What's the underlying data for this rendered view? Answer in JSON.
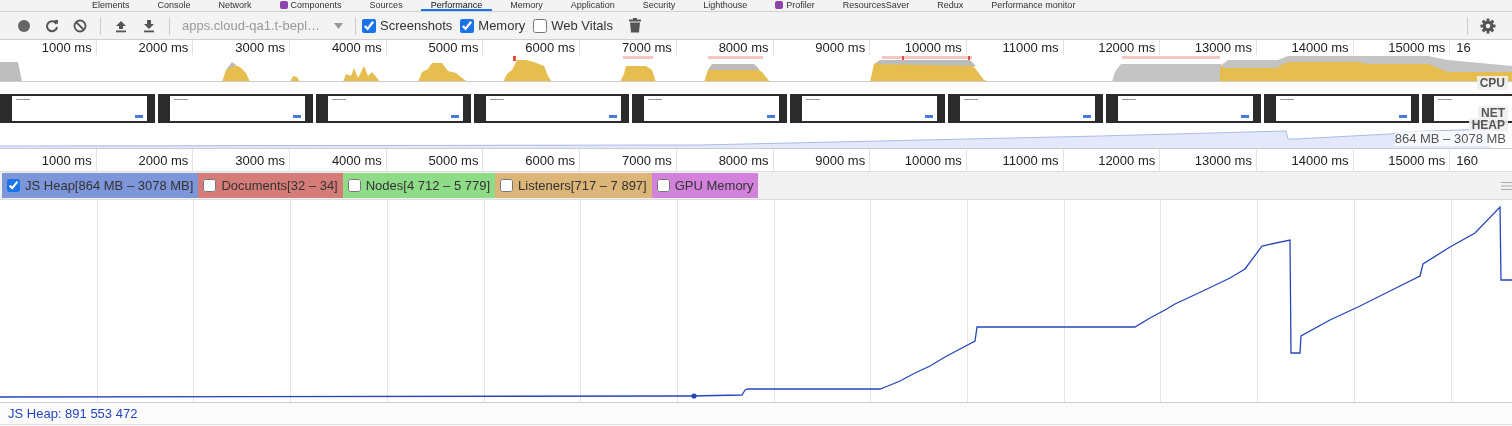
{
  "tabs": [
    {
      "label": "Elements",
      "selected": false,
      "kind": "plain"
    },
    {
      "label": "Console",
      "selected": false,
      "kind": "plain"
    },
    {
      "label": "Network",
      "selected": false,
      "kind": "plain"
    },
    {
      "label": "Components",
      "selected": false,
      "kind": "extension"
    },
    {
      "label": "Sources",
      "selected": false,
      "kind": "plain"
    },
    {
      "label": "Performance",
      "selected": true,
      "kind": "plain"
    },
    {
      "label": "Memory",
      "selected": false,
      "kind": "plain"
    },
    {
      "label": "Application",
      "selected": false,
      "kind": "plain"
    },
    {
      "label": "Security",
      "selected": false,
      "kind": "plain"
    },
    {
      "label": "Lighthouse",
      "selected": false,
      "kind": "plain"
    },
    {
      "label": "Profiler",
      "selected": false,
      "kind": "extension"
    },
    {
      "label": "ResourcesSaver",
      "selected": false,
      "kind": "plain"
    },
    {
      "label": "Redux",
      "selected": false,
      "kind": "plain"
    },
    {
      "label": "Performance monitor",
      "selected": false,
      "kind": "plain"
    }
  ],
  "toolbar": {
    "url": "apps.cloud-qa1.t-bepl…",
    "options": [
      {
        "label": "Screenshots",
        "checked": true
      },
      {
        "label": "Memory",
        "checked": true
      },
      {
        "label": "Web Vitals",
        "checked": false
      }
    ]
  },
  "overview": {
    "ticks": [
      "1000 ms",
      "2000 ms",
      "3000 ms",
      "4000 ms",
      "5000 ms",
      "6000 ms",
      "7000 ms",
      "8000 ms",
      "9000 ms",
      "10000 ms",
      "11000 ms",
      "12000 ms",
      "13000 ms",
      "14000 ms",
      "15000 ms",
      "16"
    ],
    "tracks": [
      "CPU",
      "NET",
      "HEAP"
    ],
    "heap_range": "864 MB – 3078 MB"
  },
  "ruler": {
    "ticks": [
      "1000 ms",
      "2000 ms",
      "3000 ms",
      "4000 ms",
      "5000 ms",
      "6000 ms",
      "7000 ms",
      "8000 ms",
      "9000 ms",
      "10000 ms",
      "11000 ms",
      "12000 ms",
      "13000 ms",
      "14000 ms",
      "15000 ms",
      "160"
    ]
  },
  "counters": [
    {
      "label": "JS Heap[864 MB – 3078 MB]",
      "checked": true,
      "color": "#7d95d9"
    },
    {
      "label": "Documents[32 – 34]",
      "checked": false,
      "color": "#d67c78"
    },
    {
      "label": "Nodes[4 712 – 5 779]",
      "checked": false,
      "color": "#8fdc88"
    },
    {
      "label": "Listeners[717 – 7 897]",
      "checked": false,
      "color": "#dcb578"
    },
    {
      "label": "GPU Memory",
      "checked": false,
      "color": "#d382dc"
    }
  ],
  "status": "JS Heap: 891 553 472"
}
